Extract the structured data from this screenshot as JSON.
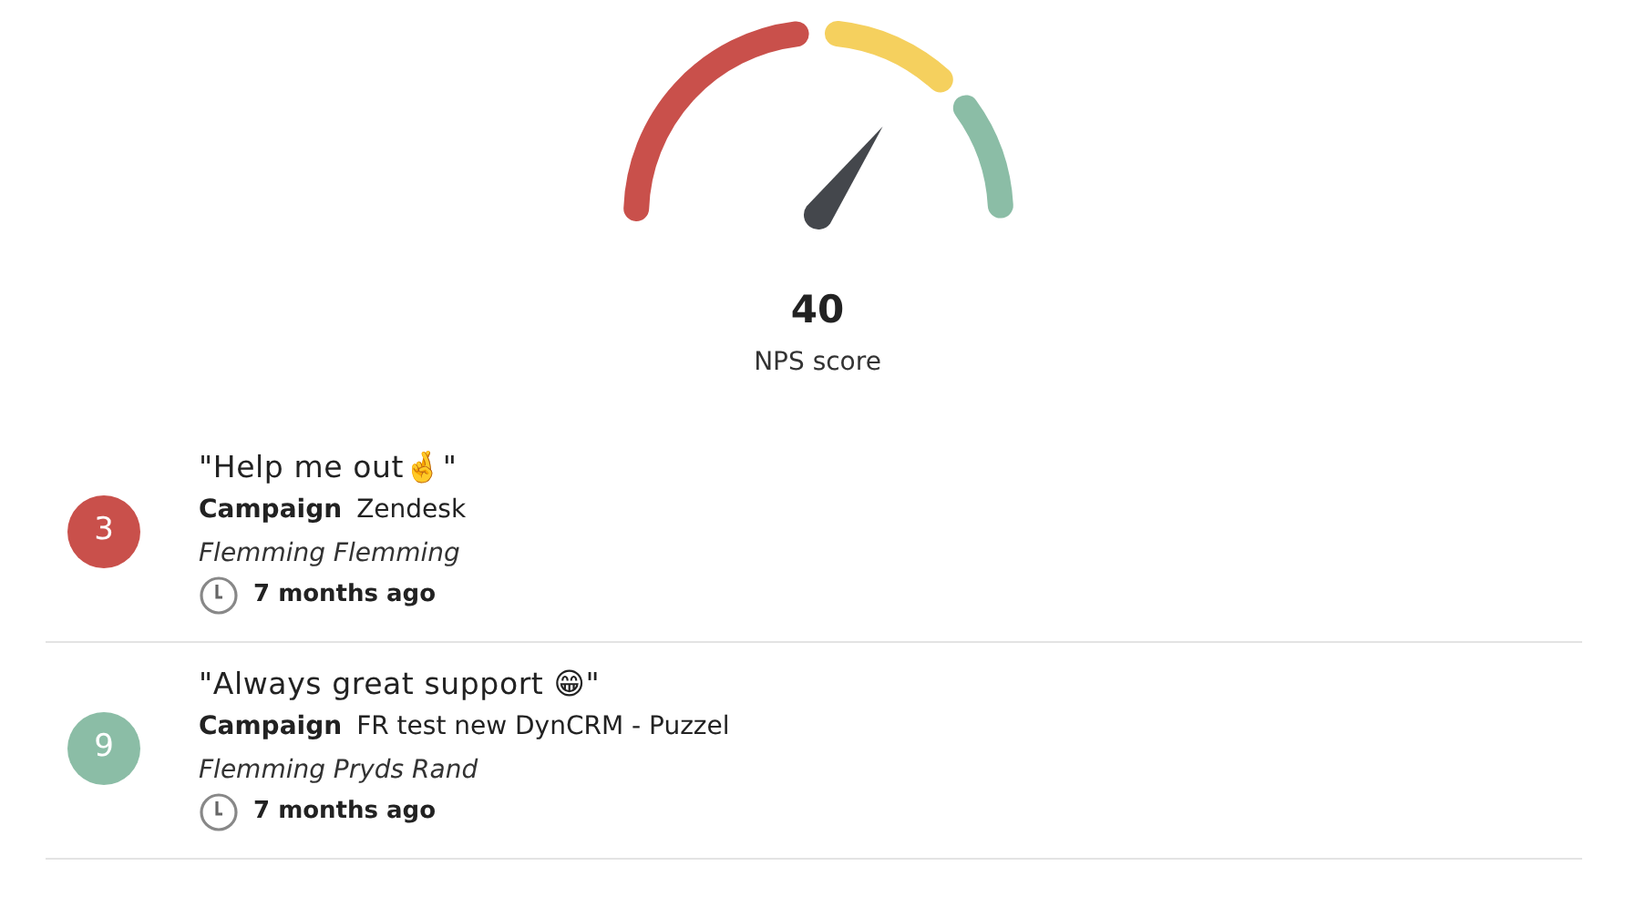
{
  "score": {
    "value": "40",
    "label": "NPS score"
  },
  "responses": [
    {
      "score": "3",
      "color": "#c9504b",
      "quote": "\"Help me out🤞\"",
      "campaign_label": "Campaign",
      "campaign": "Zendesk",
      "author": "Flemming Flemming",
      "time": "7 months ago"
    },
    {
      "score": "9",
      "color": "#8bbda6",
      "quote": "\"Always great support 😁\"",
      "campaign_label": "Campaign",
      "campaign": "FR test new DynCRM - Puzzel",
      "author": "Flemming Pryds Rand",
      "time": "7 months ago"
    }
  ]
}
